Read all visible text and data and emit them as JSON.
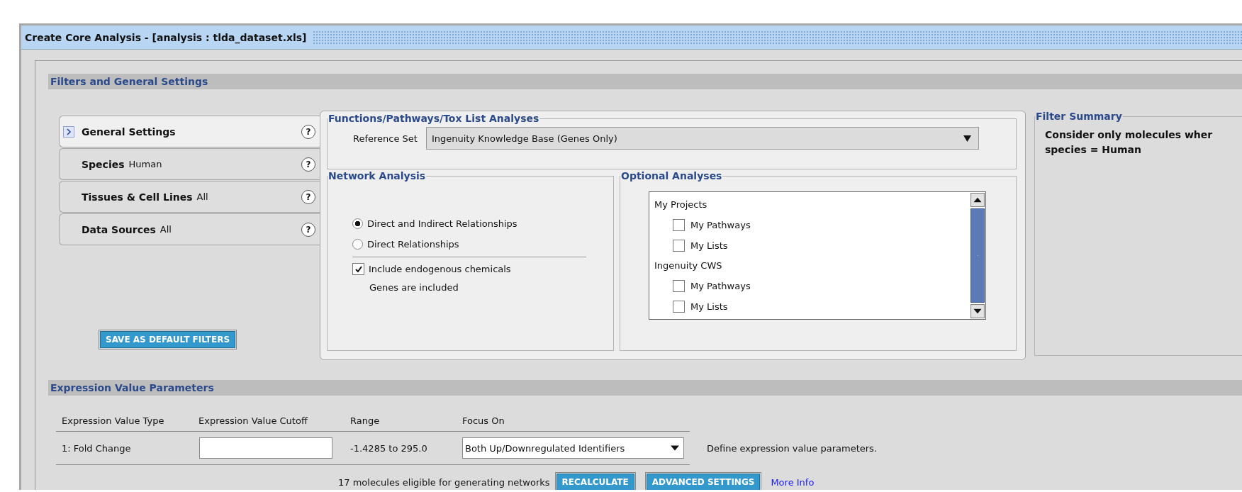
{
  "window": {
    "title": "Create Core Analysis - [analysis : tlda_dataset.xls]"
  },
  "filters_section": {
    "title": "Filters and General Settings",
    "tabs": [
      {
        "label": "General Settings",
        "selected": true,
        "help": "?"
      },
      {
        "label": "Species",
        "value": "Human",
        "selected": false,
        "help": "?"
      },
      {
        "label": "Tissues & Cell Lines",
        "value": "All",
        "selected": false,
        "help": "?"
      },
      {
        "label": "Data Sources",
        "value": "All",
        "selected": false,
        "help": "?"
      }
    ],
    "save_button": "SAVE AS DEFAULT FILTERS",
    "functions": {
      "title": "Functions/Pathways/Tox List Analyses",
      "reference_label": "Reference Set",
      "reference_value": "Ingenuity Knowledge Base (Genes Only)"
    },
    "network": {
      "title": "Network Analysis",
      "options": [
        {
          "label": "Direct and Indirect Relationships",
          "selected": true
        },
        {
          "label": "Direct Relationships",
          "selected": false
        }
      ],
      "include_endogenous": {
        "label": "Include endogenous chemicals",
        "checked": true
      },
      "note": "Genes are included"
    },
    "optional": {
      "title": "Optional Analyses",
      "groups": [
        {
          "label": "My Projects",
          "children": [
            {
              "label": "My Pathways",
              "checked": false
            },
            {
              "label": "My Lists",
              "checked": false
            }
          ]
        },
        {
          "label": "Ingenuity CWS",
          "children": [
            {
              "label": "My Pathways",
              "checked": false
            },
            {
              "label": "My Lists",
              "checked": false
            }
          ]
        }
      ]
    },
    "filter_summary": {
      "title": "Filter Summary",
      "lines": [
        "Consider only molecules wher",
        "species = Human"
      ]
    }
  },
  "expression_section": {
    "title": "Expression Value Parameters",
    "columns": [
      "Expression Value Type",
      "Expression Value Cutoff",
      "Range",
      "Focus On"
    ],
    "rows": [
      {
        "type": "1: Fold Change",
        "range": "-1.4285 to 295.0",
        "focus": "Both Up/Downregulated Identifiers"
      }
    ],
    "note": "Define expression value parameters.",
    "eligible": "17 molecules eligible for generating networks",
    "buttons": [
      "RECALCULATE",
      "ADVANCED SETTINGS"
    ],
    "link": "More Info"
  }
}
